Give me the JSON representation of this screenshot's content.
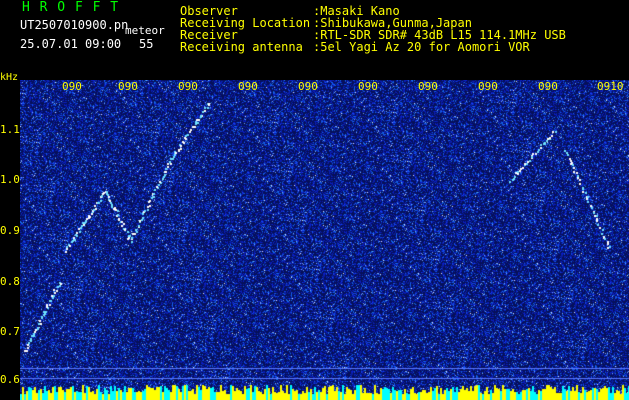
{
  "header": {
    "brand": "H R O F F T",
    "file_name": "UT2507010900.pn",
    "file_type": "meteor",
    "datetime": "25.07.01 09:00",
    "count": "55"
  },
  "info": {
    "observer_label": "Observer",
    "observer_value": ":Masaki Kano",
    "location_label": "Receiving Location",
    "location_value": ":Shibukawa,Gunma,Japan",
    "receiver_label": "Receiver",
    "receiver_value": ":RTL-SDR SDR# 43dB L15 114.1MHz USB",
    "antenna_label": "Receiving antenna",
    "antenna_value": ":5el Yagi Az 20 for Aomori VOR"
  },
  "axis": {
    "y_unit": "kHz",
    "y_ticks": [
      "1.1",
      "1.0",
      "0.9",
      "0.8",
      "0.7",
      "0.6"
    ],
    "x_ticks": [
      "090",
      "090",
      "090",
      "090",
      "090",
      "090",
      "090",
      "090",
      "090",
      "0910"
    ]
  },
  "colors": {
    "background": "#000000",
    "label_text": "#ffff00",
    "brand_text": "#00ff00",
    "tick_text": "#ffff00",
    "noise_base": "#0a1a9a",
    "meteor_trace": "#ffffff",
    "bottom_bar": "#ffff00",
    "bottom_bar_alt": "#00ffff"
  }
}
